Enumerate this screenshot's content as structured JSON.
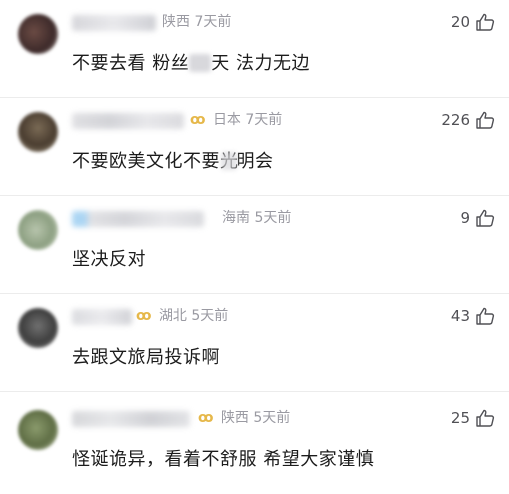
{
  "comments": [
    {
      "region": "陕西",
      "time": "7天前",
      "has_badge": false,
      "text_before": "不要去看 粉丝",
      "text_after": "天 法力无边",
      "likes": "20"
    },
    {
      "region": "日本",
      "time": "7天前",
      "has_badge": true,
      "text_before": "不要欧美文化不要光",
      "text_after": "明会",
      "likes": "226"
    },
    {
      "region": "海南",
      "time": "5天前",
      "has_badge": false,
      "text": "坚决反对",
      "likes": "9"
    },
    {
      "region": "湖北",
      "time": "5天前",
      "has_badge": true,
      "text": "去跟文旅局投诉啊",
      "likes": "43"
    },
    {
      "region": "陕西",
      "time": "5天前",
      "has_badge": true,
      "text": "怪诞诡异，看着不舒服 希望大家谨慎",
      "likes": "25"
    }
  ],
  "icons": {
    "like": "thumbs-up-outline-icon",
    "badge": "infinity-badge-icon"
  },
  "colors": {
    "meta_gray": "#9a9aa2",
    "badge_gold": "#e6b84a",
    "text_dark": "#1c1c1c",
    "divider": "#ececec"
  }
}
